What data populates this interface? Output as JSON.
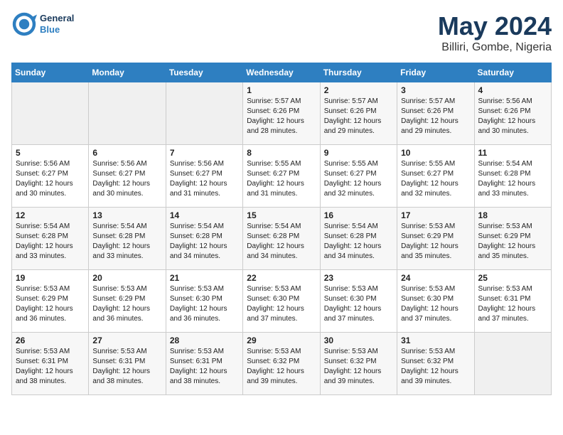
{
  "header": {
    "logo_general": "General",
    "logo_blue": "Blue",
    "title": "May 2024",
    "subtitle": "Billiri, Gombe, Nigeria"
  },
  "days_of_week": [
    "Sunday",
    "Monday",
    "Tuesday",
    "Wednesday",
    "Thursday",
    "Friday",
    "Saturday"
  ],
  "weeks": [
    {
      "row_class": "row-odd",
      "days": [
        {
          "num": "",
          "info": "",
          "empty": true
        },
        {
          "num": "",
          "info": "",
          "empty": true
        },
        {
          "num": "",
          "info": "",
          "empty": true
        },
        {
          "num": "1",
          "info": "Sunrise: 5:57 AM\nSunset: 6:26 PM\nDaylight: 12 hours\nand 28 minutes.",
          "empty": false
        },
        {
          "num": "2",
          "info": "Sunrise: 5:57 AM\nSunset: 6:26 PM\nDaylight: 12 hours\nand 29 minutes.",
          "empty": false
        },
        {
          "num": "3",
          "info": "Sunrise: 5:57 AM\nSunset: 6:26 PM\nDaylight: 12 hours\nand 29 minutes.",
          "empty": false
        },
        {
          "num": "4",
          "info": "Sunrise: 5:56 AM\nSunset: 6:26 PM\nDaylight: 12 hours\nand 30 minutes.",
          "empty": false
        }
      ]
    },
    {
      "row_class": "row-even",
      "days": [
        {
          "num": "5",
          "info": "Sunrise: 5:56 AM\nSunset: 6:27 PM\nDaylight: 12 hours\nand 30 minutes.",
          "empty": false
        },
        {
          "num": "6",
          "info": "Sunrise: 5:56 AM\nSunset: 6:27 PM\nDaylight: 12 hours\nand 30 minutes.",
          "empty": false
        },
        {
          "num": "7",
          "info": "Sunrise: 5:56 AM\nSunset: 6:27 PM\nDaylight: 12 hours\nand 31 minutes.",
          "empty": false
        },
        {
          "num": "8",
          "info": "Sunrise: 5:55 AM\nSunset: 6:27 PM\nDaylight: 12 hours\nand 31 minutes.",
          "empty": false
        },
        {
          "num": "9",
          "info": "Sunrise: 5:55 AM\nSunset: 6:27 PM\nDaylight: 12 hours\nand 32 minutes.",
          "empty": false
        },
        {
          "num": "10",
          "info": "Sunrise: 5:55 AM\nSunset: 6:27 PM\nDaylight: 12 hours\nand 32 minutes.",
          "empty": false
        },
        {
          "num": "11",
          "info": "Sunrise: 5:54 AM\nSunset: 6:28 PM\nDaylight: 12 hours\nand 33 minutes.",
          "empty": false
        }
      ]
    },
    {
      "row_class": "row-odd",
      "days": [
        {
          "num": "12",
          "info": "Sunrise: 5:54 AM\nSunset: 6:28 PM\nDaylight: 12 hours\nand 33 minutes.",
          "empty": false
        },
        {
          "num": "13",
          "info": "Sunrise: 5:54 AM\nSunset: 6:28 PM\nDaylight: 12 hours\nand 33 minutes.",
          "empty": false
        },
        {
          "num": "14",
          "info": "Sunrise: 5:54 AM\nSunset: 6:28 PM\nDaylight: 12 hours\nand 34 minutes.",
          "empty": false
        },
        {
          "num": "15",
          "info": "Sunrise: 5:54 AM\nSunset: 6:28 PM\nDaylight: 12 hours\nand 34 minutes.",
          "empty": false
        },
        {
          "num": "16",
          "info": "Sunrise: 5:54 AM\nSunset: 6:28 PM\nDaylight: 12 hours\nand 34 minutes.",
          "empty": false
        },
        {
          "num": "17",
          "info": "Sunrise: 5:53 AM\nSunset: 6:29 PM\nDaylight: 12 hours\nand 35 minutes.",
          "empty": false
        },
        {
          "num": "18",
          "info": "Sunrise: 5:53 AM\nSunset: 6:29 PM\nDaylight: 12 hours\nand 35 minutes.",
          "empty": false
        }
      ]
    },
    {
      "row_class": "row-even",
      "days": [
        {
          "num": "19",
          "info": "Sunrise: 5:53 AM\nSunset: 6:29 PM\nDaylight: 12 hours\nand 36 minutes.",
          "empty": false
        },
        {
          "num": "20",
          "info": "Sunrise: 5:53 AM\nSunset: 6:29 PM\nDaylight: 12 hours\nand 36 minutes.",
          "empty": false
        },
        {
          "num": "21",
          "info": "Sunrise: 5:53 AM\nSunset: 6:30 PM\nDaylight: 12 hours\nand 36 minutes.",
          "empty": false
        },
        {
          "num": "22",
          "info": "Sunrise: 5:53 AM\nSunset: 6:30 PM\nDaylight: 12 hours\nand 37 minutes.",
          "empty": false
        },
        {
          "num": "23",
          "info": "Sunrise: 5:53 AM\nSunset: 6:30 PM\nDaylight: 12 hours\nand 37 minutes.",
          "empty": false
        },
        {
          "num": "24",
          "info": "Sunrise: 5:53 AM\nSunset: 6:30 PM\nDaylight: 12 hours\nand 37 minutes.",
          "empty": false
        },
        {
          "num": "25",
          "info": "Sunrise: 5:53 AM\nSunset: 6:31 PM\nDaylight: 12 hours\nand 37 minutes.",
          "empty": false
        }
      ]
    },
    {
      "row_class": "row-odd",
      "days": [
        {
          "num": "26",
          "info": "Sunrise: 5:53 AM\nSunset: 6:31 PM\nDaylight: 12 hours\nand 38 minutes.",
          "empty": false
        },
        {
          "num": "27",
          "info": "Sunrise: 5:53 AM\nSunset: 6:31 PM\nDaylight: 12 hours\nand 38 minutes.",
          "empty": false
        },
        {
          "num": "28",
          "info": "Sunrise: 5:53 AM\nSunset: 6:31 PM\nDaylight: 12 hours\nand 38 minutes.",
          "empty": false
        },
        {
          "num": "29",
          "info": "Sunrise: 5:53 AM\nSunset: 6:32 PM\nDaylight: 12 hours\nand 39 minutes.",
          "empty": false
        },
        {
          "num": "30",
          "info": "Sunrise: 5:53 AM\nSunset: 6:32 PM\nDaylight: 12 hours\nand 39 minutes.",
          "empty": false
        },
        {
          "num": "31",
          "info": "Sunrise: 5:53 AM\nSunset: 6:32 PM\nDaylight: 12 hours\nand 39 minutes.",
          "empty": false
        },
        {
          "num": "",
          "info": "",
          "empty": true
        }
      ]
    }
  ]
}
